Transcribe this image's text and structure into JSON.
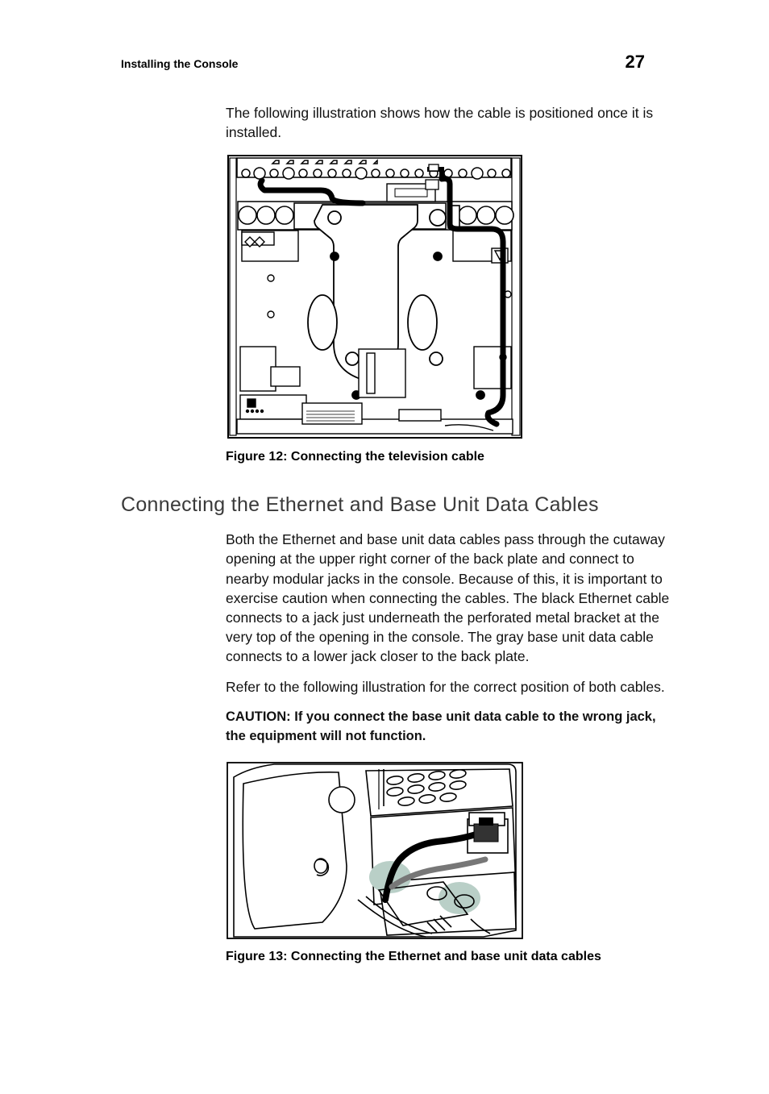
{
  "header": {
    "section_title": "Installing the Console",
    "page_number": "27"
  },
  "intro_paragraph": "The following illustration shows how the cable is positioned once it is installed.",
  "figure12_caption": "Figure 12: Connecting the television cable",
  "section_heading": "Connecting the Ethernet and Base Unit Data Cables",
  "section_p1": "Both the Ethernet and base unit data cables pass through the cutaway opening at the upper right corner of the back plate and connect to nearby modular jacks in the console. Because of this, it is important to exercise caution when connecting the cables. The black Ethernet cable connects to a jack just underneath the perforated metal bracket at the very top of the opening in the console. The gray base unit data cable connects to a lower jack closer to the back plate.",
  "section_p2": "Refer to the following illustration for the correct position of both cables.",
  "caution_text": "CAUTION: If you connect the base unit data cable to the wrong jack, the equipment will not function.",
  "figure13_caption": "Figure 13: Connecting the Ethernet and base unit data cables"
}
